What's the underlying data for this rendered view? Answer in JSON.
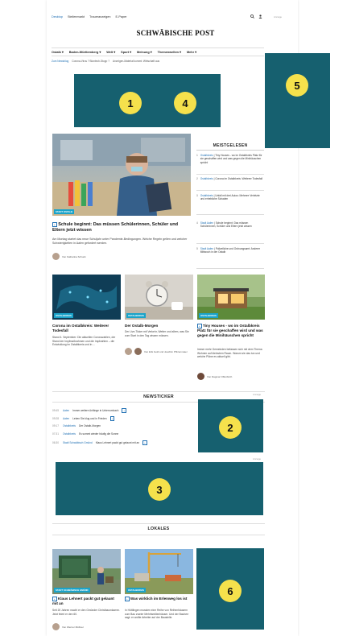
{
  "header": {
    "topnav": [
      {
        "label": "Desktop",
        "active": true
      },
      {
        "label": "Stellenmarkt",
        "active": false
      },
      {
        "label": "Traueranzeigen",
        "active": false
      },
      {
        "label": "E-Paper",
        "active": false
      }
    ],
    "anzeige": "Anzeige",
    "logo": "SCHWÄBISCHE POST",
    "icons": [
      "search-icon",
      "user-icon"
    ]
  },
  "mainnav": [
    "Ostalb ▾",
    "Baden-Württemberg ▾",
    "Welt ▾",
    "Sport ▾",
    "Meinung ▾",
    "Themenwelten ▾",
    "Mehr ▾"
  ],
  "breadcrumb": [
    "Zum Newsblog",
    "Corona-Virus ? Biontech-Stopp ?",
    "Anzeigen-Material kommt: Wirtschaft aus"
  ],
  "ads": [
    {
      "number": "1",
      "color": "#16606f"
    },
    {
      "number": "4",
      "color": "#16606f"
    },
    {
      "number": "5",
      "color": "#16606f"
    },
    {
      "number": "2",
      "color": "#16606f"
    },
    {
      "number": "3",
      "color": "#16606f"
    },
    {
      "number": "6",
      "color": "#16606f"
    }
  ],
  "hero": {
    "tag": "STADT OSTALB",
    "title": "Schule beginnt: Das müssen Schülerinnen, Schüler und Eltern jetzt wissen",
    "plus": "+",
    "teaser": "Am Montag startet das neue Schuljahr unter Pandemie-Bedingungen. Welche Regeln gelten und welcher Schwierigkeiten in Aalen gefordert werden.",
    "author": "Von Katharina Schuck"
  },
  "meistgelesen": {
    "title": "MEISTGELESEN",
    "items": [
      {
        "n": "1",
        "kicker": "Ostalbkreis",
        "text": "Tiny Houses - wo im Ostalbkreis Platz für sie geschaffen wird und was gegen die Minihäuschen spricht"
      },
      {
        "n": "2",
        "kicker": "Ostalbkreis",
        "text": "Corona im Ostalbkreis: Weiterer Todesfall"
      },
      {
        "n": "3",
        "kicker": "Ostalbkreis",
        "text": "Unfall mit drei Autos: Mehrere Verletzte und erhebliche Schaden"
      },
      {
        "n": "4",
        "kicker": "Stadt Aalen",
        "text": "Schule beginnt: Das müssen Schülerinnen, Schüler und Eltern jetzt wissen"
      },
      {
        "n": "5",
        "kicker": "Stadt Aalen",
        "text": "Polizeiliche und Ordnungsamt: Anderer Mittwoch in der Ostalb"
      }
    ]
  },
  "cards": [
    {
      "tag": "OSTALBKREIS",
      "title": "Corona im Ostalbkreis: Weiterer Todesfall",
      "text": "Stand 4. September: Die aktuellen Coronazahlen, der Stand der Impfmaßnahmen und die Impfzahlen – die Entwicklung im Ostalbkreis und in ..."
    },
    {
      "tag": "OSTALBKREIS",
      "title": "Der Ostalb-Morgen",
      "text": "Der Live-Ticker mit Verkehr, Wetter und allem, was Sie zum Start in den Tag wissen müssen.",
      "author": "Von Erik Gold und Joachim Pfitzenmaier"
    },
    {
      "tag": "OSTALBKREIS",
      "title": "Tiny Houses - wo im Ostalbkreis Platz für sie geschaffen wird und was gegen die Minihäuschen spricht",
      "plus": "+",
      "text": "Immer mehr Gemeinden befassen sich mit dem Thema Wohnen auf kleinstem Raum. Warum sie das tun und welche Pläne es aktuell gibt.",
      "author": "Von Dagmar Offenbrich"
    }
  ],
  "newsticker": {
    "title": "NEWSTICKER",
    "items": [
      {
        "time": "09:45",
        "cat": "Aalen",
        "text": "Immer weitere Anfänge in Unterrombach",
        "plus": "+"
      },
      {
        "time": "09:28",
        "cat": "Aalen",
        "text": "Leben Sie klug und in Frieden",
        "plus": "+"
      },
      {
        "time": "09:17",
        "cat": "Ostalbkreis",
        "text": "Der Ostalb-Morgen"
      },
      {
        "time": "07:31",
        "cat": "Ostalbkreis",
        "text": "Es summt wieder häufig die Sonne"
      },
      {
        "time": "06:30",
        "cat": "Stadt Schwäbisch Gmünd",
        "text": "Klaus Lehnert packt gut gelaunt mit an",
        "plus": "+"
      }
    ]
  },
  "lokales": {
    "title": "LOKALES",
    "cards": [
      {
        "tag": "STADT SCHWÄBISCH GMÜND",
        "title": "Klaus Lehnert packt gut gelaunt mit an",
        "plus": "+",
        "text": "Seit 20 Jahren macht er den Gmünder Christbaumkarren. Jetzt feiert er den 60.",
        "author": "Von Werner Mößner"
      },
      {
        "tag": "OSTALBKREIS",
        "title": "Was wirklich im Erlenweg los ist",
        "plus": "+",
        "text": "In Hüttlingen mussten eine Reihe von Reihenhäusern zum Bau zweier Mehrfamilienhäuser. Und der Bauherr sagt: er wollte Arbeiter auf der Baustelle."
      }
    ]
  }
}
